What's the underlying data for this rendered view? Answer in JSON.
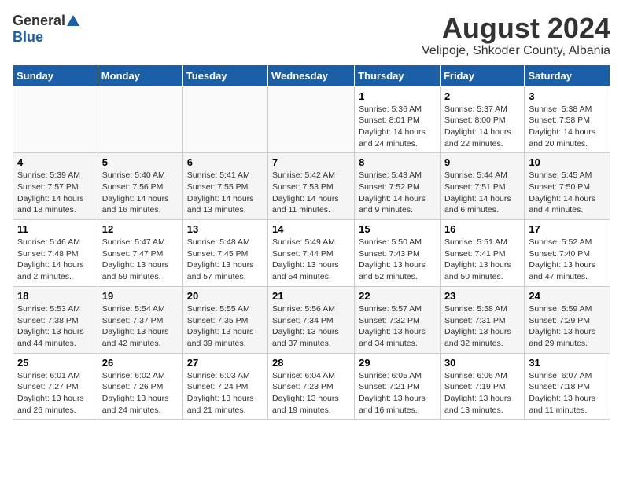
{
  "header": {
    "logo_general": "General",
    "logo_blue": "Blue",
    "month": "August 2024",
    "location": "Velipoje, Shkoder County, Albania"
  },
  "weekdays": [
    "Sunday",
    "Monday",
    "Tuesday",
    "Wednesday",
    "Thursday",
    "Friday",
    "Saturday"
  ],
  "weeks": [
    [
      {
        "day": "",
        "content": ""
      },
      {
        "day": "",
        "content": ""
      },
      {
        "day": "",
        "content": ""
      },
      {
        "day": "",
        "content": ""
      },
      {
        "day": "1",
        "content": "Sunrise: 5:36 AM\nSunset: 8:01 PM\nDaylight: 14 hours and 24 minutes."
      },
      {
        "day": "2",
        "content": "Sunrise: 5:37 AM\nSunset: 8:00 PM\nDaylight: 14 hours and 22 minutes."
      },
      {
        "day": "3",
        "content": "Sunrise: 5:38 AM\nSunset: 7:58 PM\nDaylight: 14 hours and 20 minutes."
      }
    ],
    [
      {
        "day": "4",
        "content": "Sunrise: 5:39 AM\nSunset: 7:57 PM\nDaylight: 14 hours and 18 minutes."
      },
      {
        "day": "5",
        "content": "Sunrise: 5:40 AM\nSunset: 7:56 PM\nDaylight: 14 hours and 16 minutes."
      },
      {
        "day": "6",
        "content": "Sunrise: 5:41 AM\nSunset: 7:55 PM\nDaylight: 14 hours and 13 minutes."
      },
      {
        "day": "7",
        "content": "Sunrise: 5:42 AM\nSunset: 7:53 PM\nDaylight: 14 hours and 11 minutes."
      },
      {
        "day": "8",
        "content": "Sunrise: 5:43 AM\nSunset: 7:52 PM\nDaylight: 14 hours and 9 minutes."
      },
      {
        "day": "9",
        "content": "Sunrise: 5:44 AM\nSunset: 7:51 PM\nDaylight: 14 hours and 6 minutes."
      },
      {
        "day": "10",
        "content": "Sunrise: 5:45 AM\nSunset: 7:50 PM\nDaylight: 14 hours and 4 minutes."
      }
    ],
    [
      {
        "day": "11",
        "content": "Sunrise: 5:46 AM\nSunset: 7:48 PM\nDaylight: 14 hours and 2 minutes."
      },
      {
        "day": "12",
        "content": "Sunrise: 5:47 AM\nSunset: 7:47 PM\nDaylight: 13 hours and 59 minutes."
      },
      {
        "day": "13",
        "content": "Sunrise: 5:48 AM\nSunset: 7:45 PM\nDaylight: 13 hours and 57 minutes."
      },
      {
        "day": "14",
        "content": "Sunrise: 5:49 AM\nSunset: 7:44 PM\nDaylight: 13 hours and 54 minutes."
      },
      {
        "day": "15",
        "content": "Sunrise: 5:50 AM\nSunset: 7:43 PM\nDaylight: 13 hours and 52 minutes."
      },
      {
        "day": "16",
        "content": "Sunrise: 5:51 AM\nSunset: 7:41 PM\nDaylight: 13 hours and 50 minutes."
      },
      {
        "day": "17",
        "content": "Sunrise: 5:52 AM\nSunset: 7:40 PM\nDaylight: 13 hours and 47 minutes."
      }
    ],
    [
      {
        "day": "18",
        "content": "Sunrise: 5:53 AM\nSunset: 7:38 PM\nDaylight: 13 hours and 44 minutes."
      },
      {
        "day": "19",
        "content": "Sunrise: 5:54 AM\nSunset: 7:37 PM\nDaylight: 13 hours and 42 minutes."
      },
      {
        "day": "20",
        "content": "Sunrise: 5:55 AM\nSunset: 7:35 PM\nDaylight: 13 hours and 39 minutes."
      },
      {
        "day": "21",
        "content": "Sunrise: 5:56 AM\nSunset: 7:34 PM\nDaylight: 13 hours and 37 minutes."
      },
      {
        "day": "22",
        "content": "Sunrise: 5:57 AM\nSunset: 7:32 PM\nDaylight: 13 hours and 34 minutes."
      },
      {
        "day": "23",
        "content": "Sunrise: 5:58 AM\nSunset: 7:31 PM\nDaylight: 13 hours and 32 minutes."
      },
      {
        "day": "24",
        "content": "Sunrise: 5:59 AM\nSunset: 7:29 PM\nDaylight: 13 hours and 29 minutes."
      }
    ],
    [
      {
        "day": "25",
        "content": "Sunrise: 6:01 AM\nSunset: 7:27 PM\nDaylight: 13 hours and 26 minutes."
      },
      {
        "day": "26",
        "content": "Sunrise: 6:02 AM\nSunset: 7:26 PM\nDaylight: 13 hours and 24 minutes."
      },
      {
        "day": "27",
        "content": "Sunrise: 6:03 AM\nSunset: 7:24 PM\nDaylight: 13 hours and 21 minutes."
      },
      {
        "day": "28",
        "content": "Sunrise: 6:04 AM\nSunset: 7:23 PM\nDaylight: 13 hours and 19 minutes."
      },
      {
        "day": "29",
        "content": "Sunrise: 6:05 AM\nSunset: 7:21 PM\nDaylight: 13 hours and 16 minutes."
      },
      {
        "day": "30",
        "content": "Sunrise: 6:06 AM\nSunset: 7:19 PM\nDaylight: 13 hours and 13 minutes."
      },
      {
        "day": "31",
        "content": "Sunrise: 6:07 AM\nSunset: 7:18 PM\nDaylight: 13 hours and 11 minutes."
      }
    ]
  ]
}
